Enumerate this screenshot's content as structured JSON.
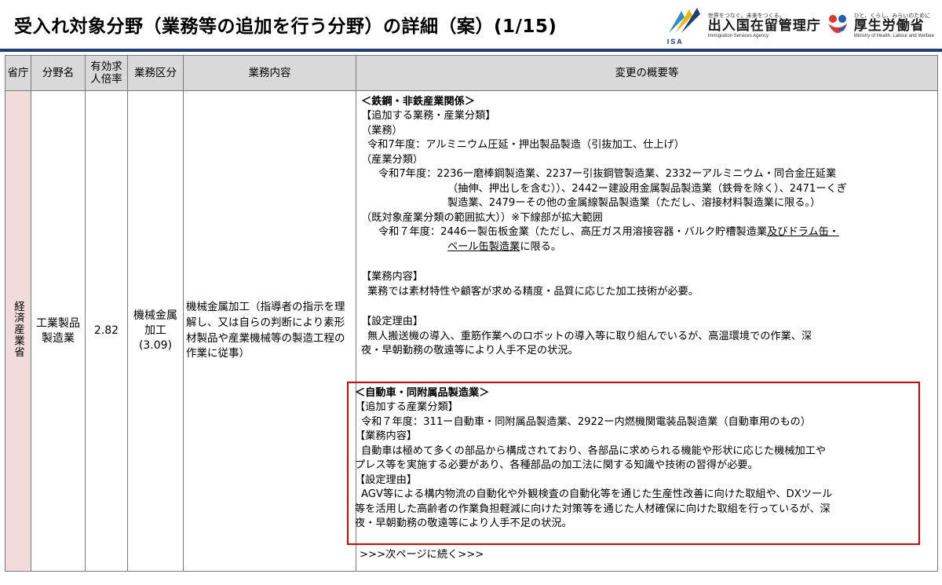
{
  "header": {
    "title": "受入れ対象分野（業務等の追加を行う分野）の詳細（案）(1/15)",
    "isa_logo": {
      "icon": "isa-swoosh-icon",
      "tagline": "世界をつなぐ。未来をつくる。",
      "name": "出入国在留管理庁",
      "english": "Immigration Services Agency",
      "mark": "ISA"
    },
    "mhlw_logo": {
      "icon": "mhlw-heart-icon",
      "tagline": "ひと、くらし、みらいのために",
      "name": "厚生労働省",
      "english": "Ministry of Health, Labour and Welfare"
    }
  },
  "table": {
    "headers": [
      "省庁",
      "分野名",
      "有効求人倍率",
      "業務区分",
      "業務内容",
      "変更の概要等"
    ],
    "row": {
      "ministry": "経済産業省",
      "field": "工業製品製造業",
      "ratio": "2.82",
      "category": "機械金属加工",
      "category_ratio": "(3.09)",
      "content": "機械金属加工（指導者の指示を理解し、又は自らの判断により素形材製品や産業機械等の製造工程の作業に従事）"
    },
    "summary": {
      "sec1": {
        "heading": "＜鉄鋼・非鉄産業関係＞",
        "add_label": "【追加する業務・産業分類】",
        "work_label": "（業務）",
        "work_line": "令和7年度：アルミニウム圧延・押出製品製造（引抜加工、仕上げ）",
        "ind_label": "（産業分類）",
        "ind_line1": "令和7年度：2236ー磨棒鋼製造業、2237ー引抜鋼管製造業、2332ーアルミニウム・同合金圧延業",
        "ind_line2": "（抽伸、押出しを含む））、2442ー建設用金属製品製造業（鉄骨を除く）、2471ーくぎ",
        "ind_line3": "製造業、2479ーその他の金属線製品製造業（ただし、溶接材料製造業に限る。）",
        "expand_label": "（既対象産業分類の範囲拡大））※下線部が拡大範囲",
        "expand_line1_a": "令和７年度：2446ー製缶板金業（ただし、高圧ガス用溶接容器・バルク貯槽製造業",
        "expand_line1_u": "及びドラム缶・",
        "expand_line2_u": "ベール缶製造業",
        "expand_line2_b": "に限る。",
        "duty_label": "【業務内容】",
        "duty_text": "業務では素材特性や顧客が求める精度・品質に応じた加工技術が必要。",
        "reason_label": "【設定理由】",
        "reason_line1": "無人搬送機の導入、重筋作業へのロボットの導入等に取り組んでいるが、高温環境での作業、深",
        "reason_line2": "夜・早朝勤務の敬遠等により人手不足の状況。"
      },
      "sec2": {
        "heading": "＜自動車・同附属品製造業＞",
        "add_label": "【追加する産業分類】",
        "add_line": "令和７年度：311ー自動車・同附属品製造業、2922ー内燃機関電装品製造業（自動車用のもの）",
        "duty_label": "【業務内容】",
        "duty_line1": "自動車は極めて多くの部品から構成されており、各部品に求められる機能や形状に応じた機械加工や",
        "duty_line2": "プレス等を実施する必要があり、各種部品の加工法に関する知識や技術の習得が必要。",
        "reason_label": "【設定理由】",
        "reason_line1": "AGV等による構内物流の自動化や外観検査の自動化等を通じた生産性改善に向けた取組や、DXツール",
        "reason_line2": "等を活用した高齢者の作業負担軽減に向けた対策等を通じた人材確保に向けた取組を行っているが、深",
        "reason_line3": "夜・早朝勤務の敬遠等により人手不足の状況。"
      },
      "continued": ">>>次ページに続く>>>"
    }
  },
  "colors": {
    "header_rule": "#1e3f7a",
    "header_cell": "#d9d9d9",
    "ministry_cell": "#f2dbdb",
    "highlight_border": "#e00000"
  }
}
